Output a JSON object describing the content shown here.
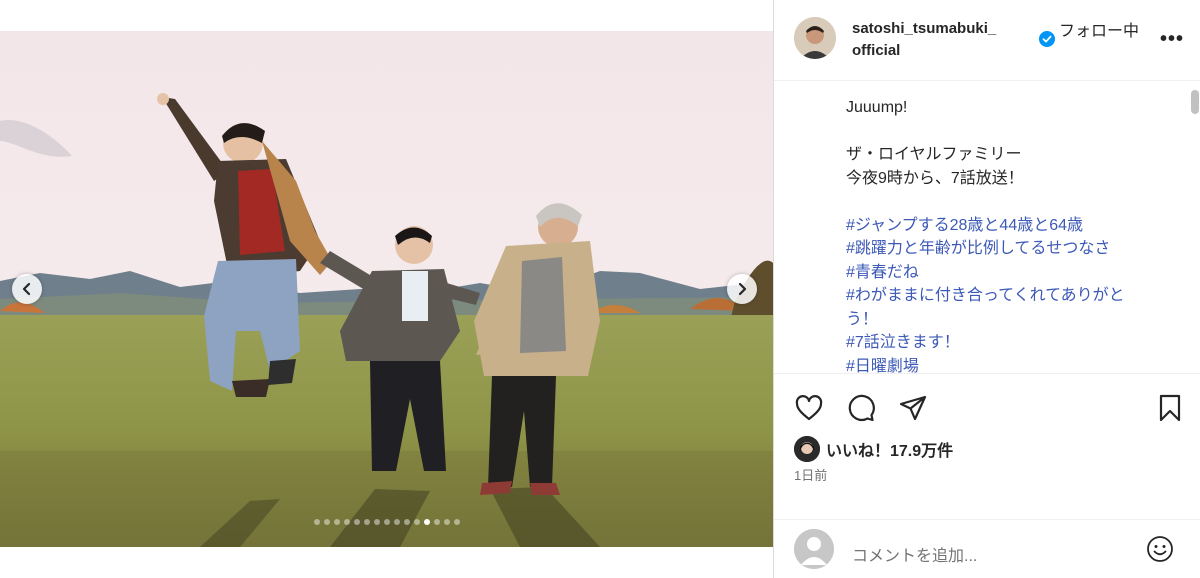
{
  "header": {
    "username": "satoshi_tsumabuki_ official",
    "follow_label": "フォロー中",
    "more_label": "•••"
  },
  "caption": {
    "lines": [
      "Juuump!",
      "",
      "ザ・ロイヤルファミリー",
      "今夜9時から、7話放送！",
      ""
    ],
    "hashtags": [
      "#ジャンプする28歳と44歳と64歳",
      "#跳躍力と年齢が比例してるせつなさ",
      "#青春だね",
      "#わがままに付き合ってくれてありがと",
      "う！",
      "#7話泣きます！",
      "#日曜劇場"
    ]
  },
  "engagement": {
    "likes_label": "いいね！17.9万件",
    "time_label": "1日前"
  },
  "comment": {
    "placeholder": "コメントを追加..."
  },
  "carousel": {
    "total": 15,
    "active_index": 11
  },
  "colors": {
    "hashtag": "#3c59b8",
    "verified": "#0095f6",
    "text": "#262626",
    "muted": "#737373"
  }
}
